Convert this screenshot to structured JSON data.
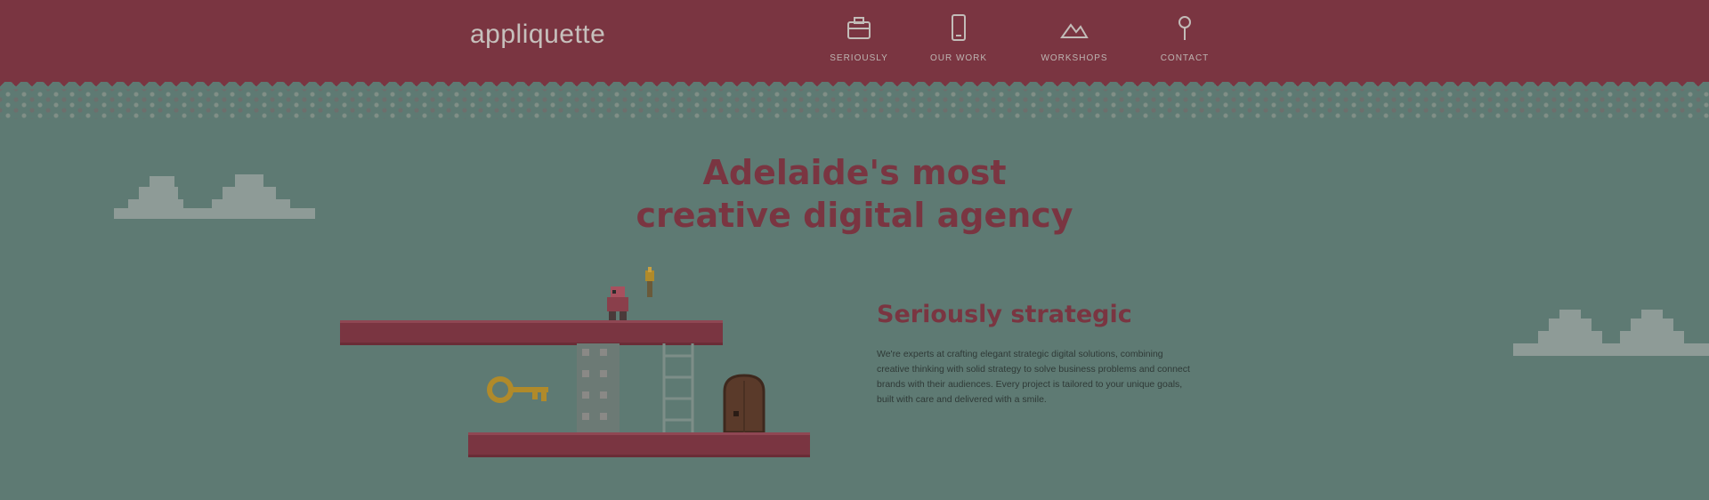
{
  "header": {
    "logo": "appliquette",
    "nav": [
      {
        "label": "Seriously",
        "icon": "briefcase-icon"
      },
      {
        "label": "Our Work",
        "icon": "phone-icon"
      },
      {
        "label": "Workshops",
        "icon": "mountain-icon"
      },
      {
        "label": "Contact",
        "icon": "pin-icon"
      }
    ]
  },
  "hero": {
    "headline_line1": "Adelaide's most",
    "headline_line2": "creative digital agency"
  },
  "section": {
    "title": "Seriously strategic",
    "body": "We're experts at crafting elegant strategic digital solutions, combining creative thinking with solid strategy to solve business problems and connect brands with their audiences. Every project is tailored to your unique goals, built with care and delivered with a smile."
  },
  "colors": {
    "brand_red": "#7a3541",
    "background": "#5e7a73",
    "cloud": "#8e9b97",
    "key_gold": "#b08a2a"
  }
}
